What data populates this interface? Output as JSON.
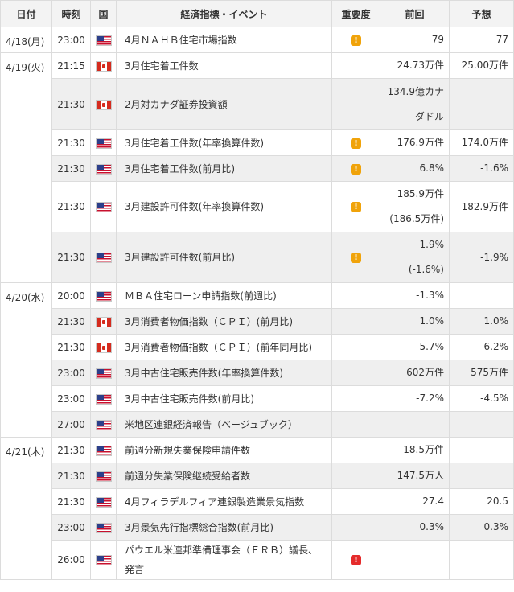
{
  "headers": {
    "date": "日付",
    "time": "時刻",
    "country": "国",
    "event": "経済指標・イベント",
    "importance": "重要度",
    "previous": "前回",
    "forecast": "予想"
  },
  "colors": {
    "importance_medium": "#f0a30a",
    "importance_high": "#e52b2b",
    "row_alt": "#efefef",
    "header_bg": "#f3f3f3"
  },
  "groups": [
    {
      "date": "4/18(月)",
      "rows": [
        {
          "time": "23:00",
          "country": "us-flag-icon",
          "event": "4月ＮＡＨＢ住宅市場指数",
          "importance": "medium",
          "previous": [
            "79"
          ],
          "forecast": "77"
        }
      ]
    },
    {
      "date": "4/19(火)",
      "rows": [
        {
          "time": "21:15",
          "country": "ca-flag-icon",
          "event": "3月住宅着工件数",
          "importance": "",
          "previous": [
            "24.73万件"
          ],
          "forecast": "25.00万件"
        },
        {
          "time": "21:30",
          "country": "ca-flag-icon",
          "event": "2月対カナダ証券投資額",
          "importance": "",
          "previous": [
            "134.9億カナ",
            "ダドル"
          ],
          "forecast": ""
        },
        {
          "time": "21:30",
          "country": "us-flag-icon",
          "event": "3月住宅着工件数(年率換算件数)",
          "importance": "medium",
          "previous": [
            "176.9万件"
          ],
          "forecast": "174.0万件"
        },
        {
          "time": "21:30",
          "country": "us-flag-icon",
          "event": "3月住宅着工件数(前月比)",
          "importance": "medium",
          "previous": [
            "6.8%"
          ],
          "forecast": "-1.6%"
        },
        {
          "time": "21:30",
          "country": "us-flag-icon",
          "event": "3月建設許可件数(年率換算件数)",
          "importance": "medium",
          "previous": [
            "185.9万件",
            "(186.5万件)"
          ],
          "forecast": "182.9万件"
        },
        {
          "time": "21:30",
          "country": "us-flag-icon",
          "event": "3月建設許可件数(前月比)",
          "importance": "medium",
          "previous": [
            "-1.9%",
            "(-1.6%)"
          ],
          "forecast": "-1.9%"
        }
      ]
    },
    {
      "date": "4/20(水)",
      "rows": [
        {
          "time": "20:00",
          "country": "us-flag-icon",
          "event": "ＭＢＡ住宅ローン申請指数(前週比)",
          "importance": "",
          "previous": [
            "-1.3%"
          ],
          "forecast": ""
        },
        {
          "time": "21:30",
          "country": "ca-flag-icon",
          "event": "3月消費者物価指数（ＣＰＩ）(前月比)",
          "importance": "",
          "previous": [
            "1.0%"
          ],
          "forecast": "1.0%"
        },
        {
          "time": "21:30",
          "country": "ca-flag-icon",
          "event": "3月消費者物価指数（ＣＰＩ）(前年同月比)",
          "importance": "",
          "previous": [
            "5.7%"
          ],
          "forecast": "6.2%"
        },
        {
          "time": "23:00",
          "country": "us-flag-icon",
          "event": "3月中古住宅販売件数(年率換算件数)",
          "importance": "",
          "previous": [
            "602万件"
          ],
          "forecast": "575万件"
        },
        {
          "time": "23:00",
          "country": "us-flag-icon",
          "event": "3月中古住宅販売件数(前月比)",
          "importance": "",
          "previous": [
            "-7.2%"
          ],
          "forecast": "-4.5%"
        },
        {
          "time": "27:00",
          "country": "us-flag-icon",
          "event": "米地区連銀経済報告（ベージュブック）",
          "importance": "",
          "previous": [
            ""
          ],
          "forecast": ""
        }
      ]
    },
    {
      "date": "4/21(木)",
      "rows": [
        {
          "time": "21:30",
          "country": "us-flag-icon",
          "event": "前週分新規失業保険申請件数",
          "importance": "",
          "previous": [
            "18.5万件"
          ],
          "forecast": ""
        },
        {
          "time": "21:30",
          "country": "us-flag-icon",
          "event": "前週分失業保険継続受給者数",
          "importance": "",
          "previous": [
            "147.5万人"
          ],
          "forecast": ""
        },
        {
          "time": "21:30",
          "country": "us-flag-icon",
          "event": "4月フィラデルフィア連銀製造業景気指数",
          "importance": "",
          "previous": [
            "27.4"
          ],
          "forecast": "20.5"
        },
        {
          "time": "23:00",
          "country": "us-flag-icon",
          "event": "3月景気先行指標総合指数(前月比)",
          "importance": "",
          "previous": [
            "0.3%"
          ],
          "forecast": "0.3%"
        },
        {
          "time": "26:00",
          "country": "us-flag-icon",
          "event": "パウエル米連邦準備理事会（ＦＲＢ）議長、発言",
          "importance": "high",
          "previous": [
            ""
          ],
          "forecast": ""
        }
      ]
    }
  ]
}
